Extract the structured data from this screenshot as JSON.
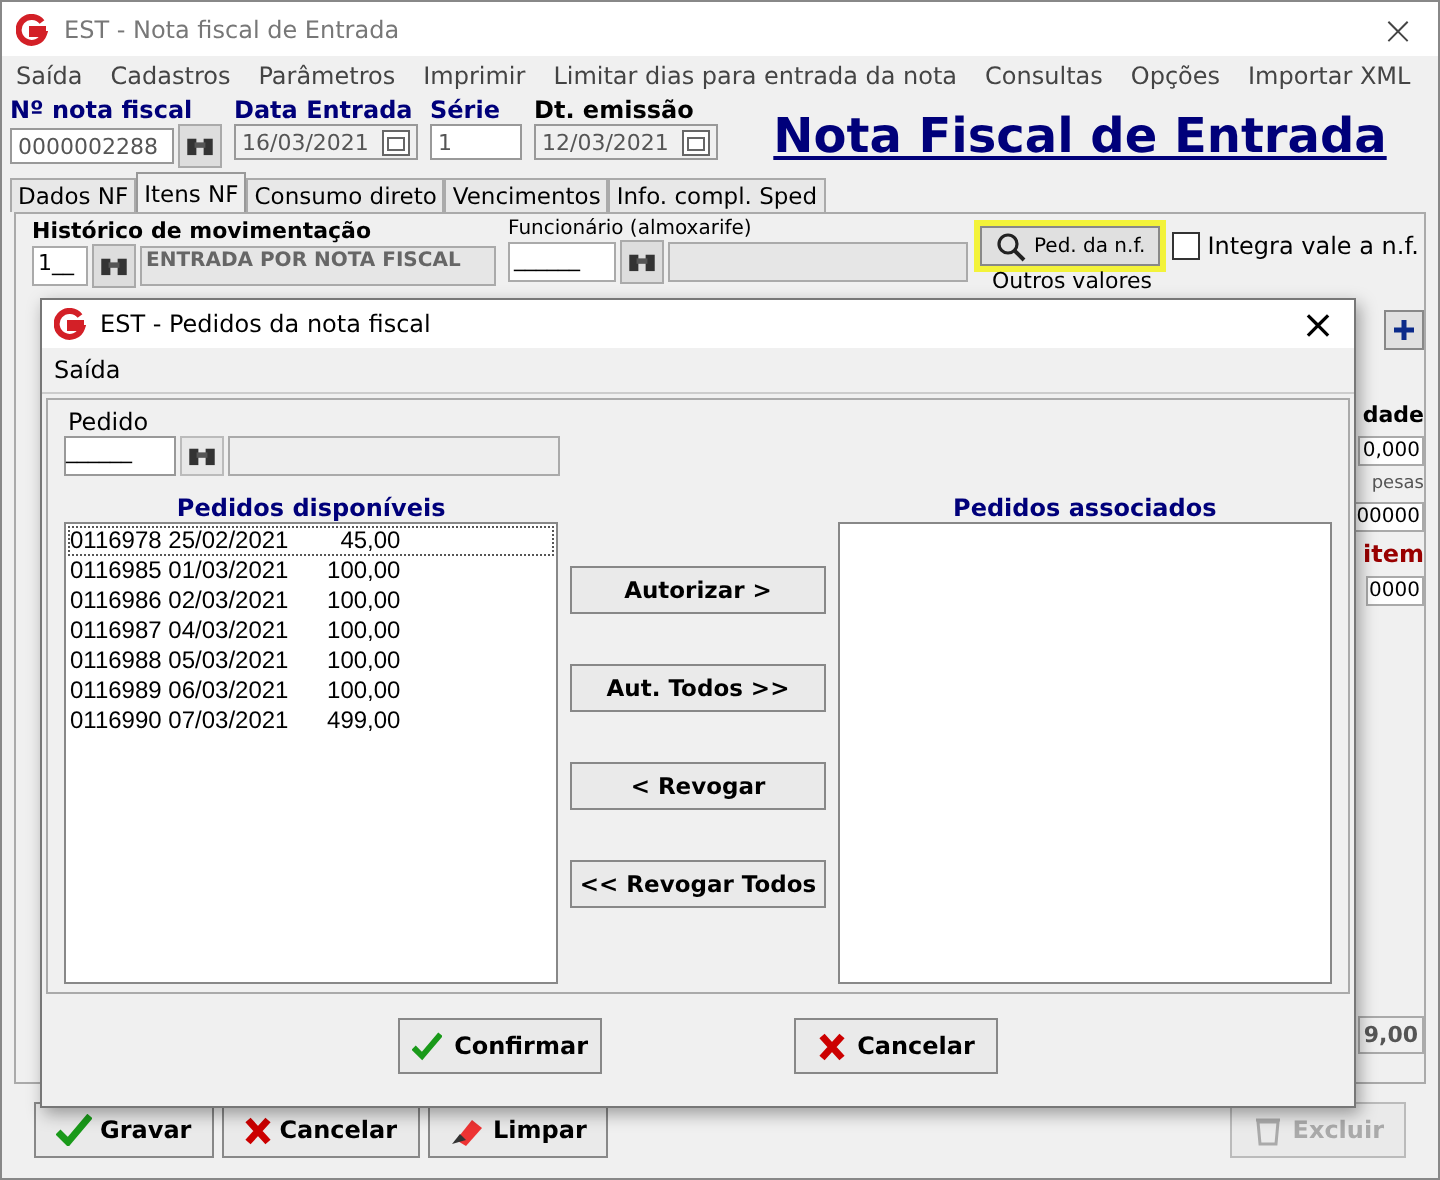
{
  "window": {
    "title": "EST - Nota fiscal de Entrada",
    "close": "×"
  },
  "menu": [
    "Saída",
    "Cadastros",
    "Parâmetros",
    "Imprimir",
    "Limitar dias para entrada da nota",
    "Consultas",
    "Opções",
    "Importar XML"
  ],
  "header": {
    "fields": [
      {
        "label": "Nº nota fiscal",
        "value": "0000002288",
        "kind": "search"
      },
      {
        "label": "Data Entrada",
        "value": "16/03/2021",
        "kind": "date"
      },
      {
        "label": "Série",
        "value": "1",
        "kind": "plain"
      },
      {
        "label": "Dt. emissão",
        "value": "12/03/2021",
        "kind": "date"
      }
    ],
    "heading": "Nota Fiscal de Entrada"
  },
  "tabs": [
    {
      "label": "Dados NF",
      "selected": false
    },
    {
      "label": "Itens NF",
      "selected": true
    },
    {
      "label": "Consumo direto",
      "selected": false
    },
    {
      "label": "Vencimentos",
      "selected": false
    },
    {
      "label": "Info. compl. Sped",
      "selected": false
    }
  ],
  "panel": {
    "historico_label": "Histórico de movimentação",
    "historico_code": "1__",
    "historico_value": "ENTRADA POR NOTA FISCAL",
    "funcionario_label": "Funcionário (almoxarife)",
    "funcionario_value": "______",
    "ped_button": {
      "label": "Ped. da n.f.",
      "highlighted": true
    },
    "integra": {
      "label": "Integra vale a n.f.",
      "checked": false
    },
    "outros_label": "Outros valores",
    "side": [
      {
        "text": "dade",
        "kind": "label"
      },
      {
        "text": "0,000",
        "kind": "value"
      },
      {
        "text": "pesas",
        "kind": "small"
      },
      {
        "text": "00000",
        "kind": "value"
      },
      {
        "text": "item",
        "kind": "alert"
      },
      {
        "text": "0000",
        "kind": "value"
      }
    ],
    "total": "9,00"
  },
  "bottom_buttons": [
    {
      "label": "Gravar",
      "kind": "confirm",
      "disabled": false
    },
    {
      "label": "Cancelar",
      "kind": "cancel",
      "disabled": false
    },
    {
      "label": "Limpar",
      "kind": "clear",
      "disabled": false
    },
    {
      "label": "Excluir",
      "kind": "delete",
      "disabled": true
    }
  ],
  "dialog": {
    "title": "EST - Pedidos da nota fiscal",
    "close": "×",
    "menu": [
      "Saída"
    ],
    "pedido_label": "Pedido",
    "pedido_value": "______",
    "available_title": "Pedidos disponíveis",
    "available": [
      {
        "code": "0116978",
        "date": "25/02/2021",
        "amount": "45,00",
        "selected": true
      },
      {
        "code": "0116985",
        "date": "01/03/2021",
        "amount": "100,00",
        "selected": false
      },
      {
        "code": "0116986",
        "date": "02/03/2021",
        "amount": "100,00",
        "selected": false
      },
      {
        "code": "0116987",
        "date": "04/03/2021",
        "amount": "100,00",
        "selected": false
      },
      {
        "code": "0116988",
        "date": "05/03/2021",
        "amount": "100,00",
        "selected": false
      },
      {
        "code": "0116989",
        "date": "06/03/2021",
        "amount": "100,00",
        "selected": false
      },
      {
        "code": "0116990",
        "date": "07/03/2021",
        "amount": "499,00",
        "selected": false
      }
    ],
    "associated_title": "Pedidos associados",
    "actions": [
      "Autorizar >",
      "Aut. Todos >>",
      "< Revogar",
      "<< Revogar Todos"
    ],
    "buttons": [
      {
        "label": "Confirmar",
        "kind": "confirm"
      },
      {
        "label": "Cancelar",
        "kind": "cancel"
      }
    ]
  }
}
